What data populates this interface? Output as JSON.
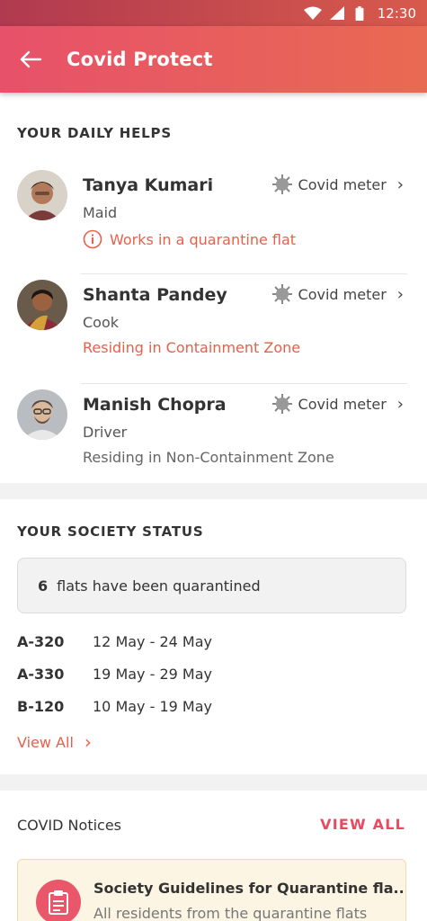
{
  "status_bar": {
    "time": "12:30"
  },
  "app_bar": {
    "title": "Covid Protect",
    "back_icon": "arrow-left-icon"
  },
  "daily_helps": {
    "title": "YOUR DAILY HELPS",
    "meter_label": "Covid meter",
    "items": [
      {
        "name": "Tanya Kumari",
        "role": "Maid",
        "status": "Works in a quarantine flat",
        "status_color": "#e8604a",
        "status_icon": "info-icon"
      },
      {
        "name": "Shanta Pandey",
        "role": "Cook",
        "status": "Residing in Containment Zone",
        "status_color": "#e8604a"
      },
      {
        "name": "Manish Chopra",
        "role": "Driver",
        "status": "Residing in Non-Containment Zone",
        "status_color": "#666666"
      }
    ]
  },
  "society_status": {
    "title": "YOUR SOCIETY STATUS",
    "quarantine_count": "6",
    "quarantine_text": "flats have been quarantined",
    "flats": [
      {
        "flat": "A-320",
        "dates": "12 May - 24 May"
      },
      {
        "flat": "A-330",
        "dates": "19 May - 29 May"
      },
      {
        "flat": "B-120",
        "dates": "10 May - 19 May"
      }
    ],
    "view_all": "View All"
  },
  "notices": {
    "title": "COVID Notices",
    "view_all": "VIEW ALL",
    "items": [
      {
        "title": "Society Guidelines for Quarantine fla..",
        "subtitle": "All residents from the quarantine flats"
      }
    ]
  },
  "colors": {
    "accent": "#e94a60",
    "warning": "#e8604a",
    "app_bar_start": "#e7516a",
    "app_bar_end": "#e96a52"
  }
}
